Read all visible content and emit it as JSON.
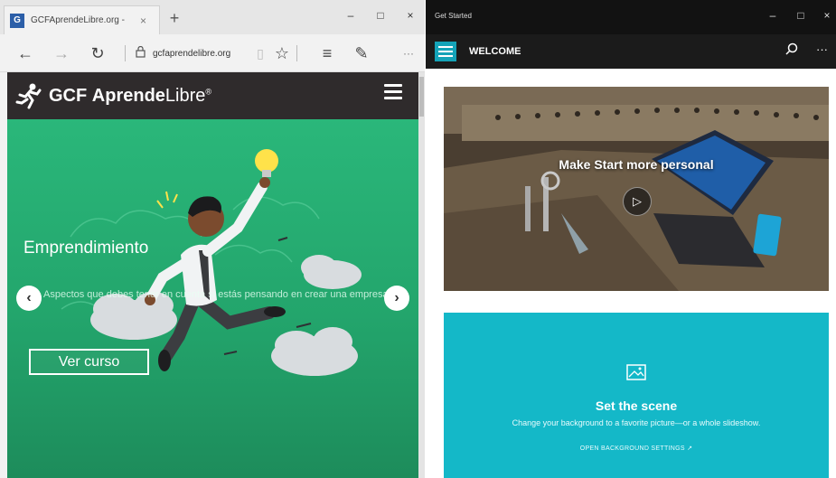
{
  "edge": {
    "tab_title": "GCFAprendeLibre.org -",
    "tab_close": "×",
    "new_tab": "+",
    "window_controls": {
      "minimize": "–",
      "maximize": "□",
      "close": "×"
    },
    "nav": {
      "back": "←",
      "forward": "→",
      "refresh": "↻",
      "url": "gcfaprendelibre.org",
      "reading_view": "▯",
      "favorite": "☆",
      "hub": "≡",
      "web_note": "✎",
      "more": "···"
    }
  },
  "gcf": {
    "logo_bold": "GCF",
    "logo_middle": "Aprende",
    "logo_thin": "Libre",
    "logo_reg": "®",
    "hero_title": "Emprendimiento",
    "hero_description": "Aspectos que debes tener en cuenta si estás pensando en crear una empresa.",
    "prev_arrow": "‹",
    "next_arrow": "›",
    "hero_button": "Ver curso"
  },
  "get_started": {
    "window_title": "Get Started",
    "window_controls": {
      "minimize": "–",
      "maximize": "□",
      "close": "×"
    },
    "header_title": "WELCOME",
    "search_glyph": "⌕",
    "more_glyph": "···",
    "video_title": "Make Start more personal",
    "play_glyph": "▷",
    "scene_title": "Set the scene",
    "scene_description": "Change your background to a favorite picture—or a whole slideshow.",
    "scene_link": "OPEN BACKGROUND SETTINGS ↗"
  },
  "colors": {
    "gcf_header": "#2f2b2c",
    "gcf_green": "#2ab77a",
    "gs_accent": "#14a3b8",
    "gs_scene": "#14b8c8"
  }
}
